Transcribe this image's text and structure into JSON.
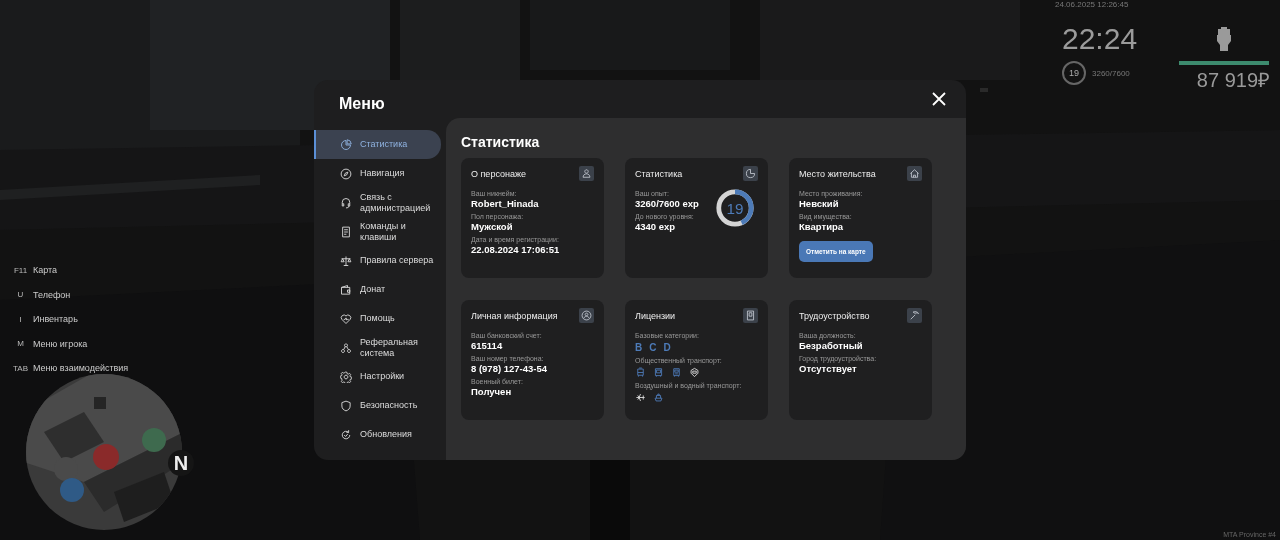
{
  "hud": {
    "datetime": "24.06.2025 12:26:45",
    "time": "22:24",
    "level": "19",
    "experience": "3260/7600",
    "money": "87 919₽"
  },
  "keybinds": [
    {
      "key": "F11",
      "action": "Карта"
    },
    {
      "key": "U",
      "action": "Телефон"
    },
    {
      "key": "I",
      "action": "Инвентарь"
    },
    {
      "key": "M",
      "action": "Меню игрока"
    },
    {
      "key": "TAB",
      "action": "Меню взаимодействия"
    }
  ],
  "minimap": {
    "compass": "N"
  },
  "menu": {
    "title": "Меню",
    "sidebar": {
      "items": [
        {
          "label": "Статистика",
          "selected": true
        },
        {
          "label": "Навигация",
          "selected": false
        },
        {
          "label": "Связь с администрацией",
          "selected": false
        },
        {
          "label": "Команды и клавиши",
          "selected": false
        },
        {
          "label": "Правила сервера",
          "selected": false
        },
        {
          "label": "Донат",
          "selected": false
        },
        {
          "label": "Помощь",
          "selected": false
        },
        {
          "label": "Реферальная система",
          "selected": false
        },
        {
          "label": "Настройки",
          "selected": false
        },
        {
          "label": "Безопасность",
          "selected": false
        },
        {
          "label": "Обновления",
          "selected": false
        }
      ]
    },
    "page_title": "Статистика",
    "cards": [
      {
        "kind": "fields",
        "title": "О персонаже",
        "fields": [
          {
            "label": "Ваш никнейм:",
            "value": "Robert_Hinada"
          },
          {
            "label": "Пол персонажа:",
            "value": "Мужской"
          },
          {
            "label": "Дата и время регистрации:",
            "value": "22.08.2024 17:06:51"
          }
        ]
      },
      {
        "kind": "progress",
        "title": "Статистика",
        "fields": [
          {
            "label": "Ваш опыт:",
            "value": "3260/7600 exp"
          },
          {
            "label": "До нового уровня:",
            "value": "4340 exp"
          }
        ],
        "ring": {
          "level": 0.43,
          "text": "19"
        }
      },
      {
        "kind": "fields",
        "title": "Место жительства",
        "fields": [
          {
            "label": "Место проживания:",
            "value": "Невский"
          },
          {
            "label": "Вид имущества:",
            "value": "Квартира"
          }
        ],
        "button": "Отметить на карте"
      },
      {
        "kind": "fields",
        "title": "Личная информация",
        "fields": [
          {
            "label": "Ваш банковский счет:",
            "value": "615114"
          },
          {
            "label": "Ваш номер телефона:",
            "value": "8 (978) 127-43-54"
          },
          {
            "label": "Военный билет:",
            "value": "Получен"
          }
        ]
      },
      {
        "kind": "licenses",
        "title": "Лицензии",
        "groups": [
          {
            "kind": "letters",
            "label": "Базовые категории:",
            "items": [
              {
                "text": "B",
                "active": true
              },
              {
                "text": "C",
                "active": true
              },
              {
                "text": "D",
                "active": true
              }
            ]
          },
          {
            "kind": "icons",
            "label": "Общественный транспорт:",
            "items": [
              {
                "active": true
              },
              {
                "active": true
              },
              {
                "active": true
              },
              {
                "active": false
              }
            ]
          },
          {
            "kind": "icons",
            "label": "Воздушный и водный транспорт:",
            "items": [
              {
                "active": false
              },
              {
                "active": true
              }
            ]
          }
        ]
      },
      {
        "kind": "fields",
        "title": "Трудоустройство",
        "fields": [
          {
            "label": "Ваша должность:",
            "value": "Безработный"
          },
          {
            "label": "Город трудоустройства:",
            "value": "Отсутствует"
          }
        ]
      }
    ]
  },
  "watermark_server": "MTA Province #4"
}
